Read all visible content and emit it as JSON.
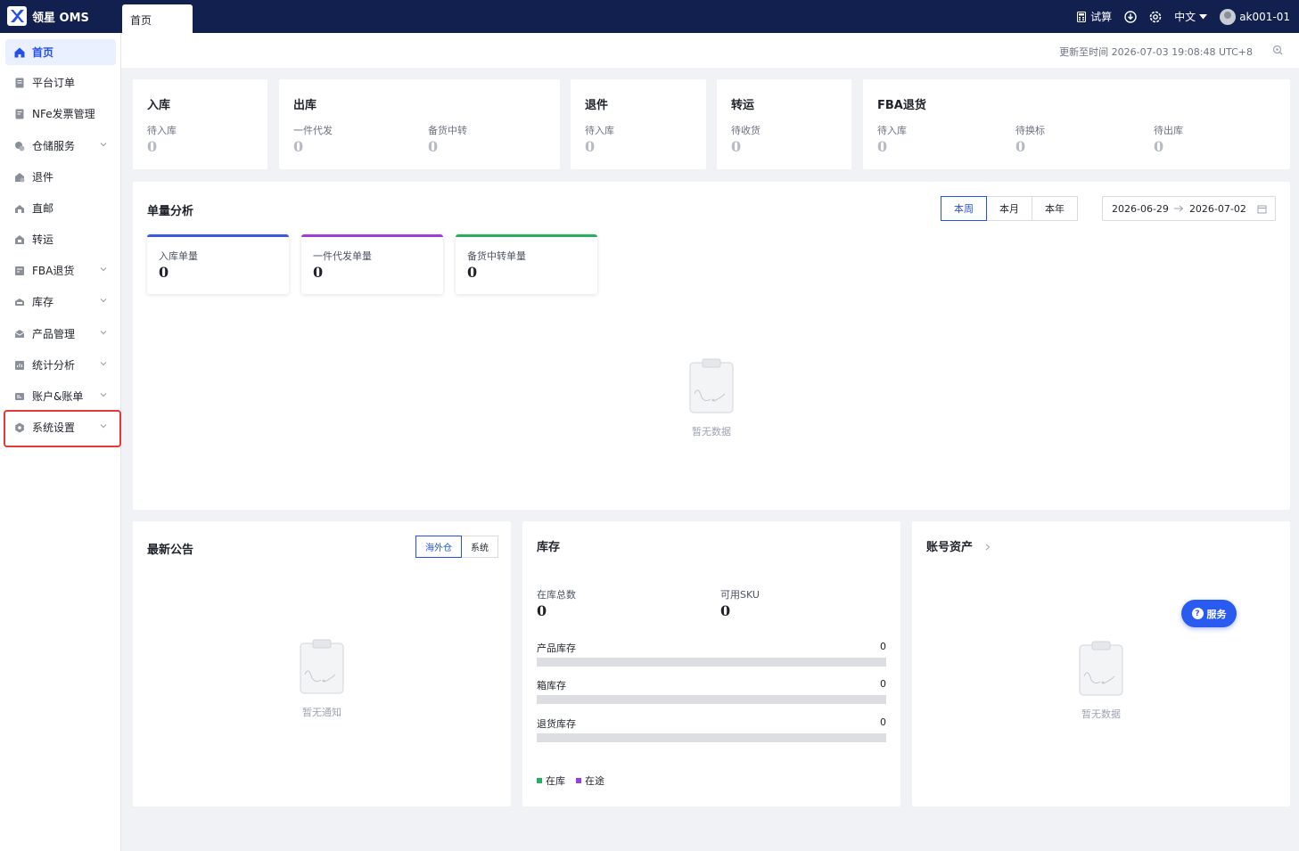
{
  "app": {
    "title": "领星 OMS",
    "active_tab": "首页"
  },
  "topbar": {
    "trial": "试算",
    "language": "中文",
    "user": "ak001-01"
  },
  "sidebar": {
    "items": [
      {
        "label": "首页",
        "icon": "home-icon",
        "active": true
      },
      {
        "label": "平台订单",
        "icon": "order-icon"
      },
      {
        "label": "NFe发票管理",
        "icon": "invoice-icon"
      },
      {
        "label": "仓储服务",
        "icon": "warehouse-icon",
        "expandable": true
      },
      {
        "label": "退件",
        "icon": "return-icon"
      },
      {
        "label": "直邮",
        "icon": "mail-icon"
      },
      {
        "label": "转运",
        "icon": "transfer-icon"
      },
      {
        "label": "FBA退货",
        "icon": "fba-icon",
        "expandable": true
      },
      {
        "label": "库存",
        "icon": "inventory-icon",
        "expandable": true
      },
      {
        "label": "产品管理",
        "icon": "product-icon",
        "expandable": true
      },
      {
        "label": "统计分析",
        "icon": "stats-icon",
        "expandable": true
      },
      {
        "label": "账户&账单",
        "icon": "account-icon",
        "expandable": true
      },
      {
        "label": "系统设置",
        "icon": "settings-icon",
        "expandable": true,
        "highlighted": true
      }
    ]
  },
  "header": {
    "update_time": "更新至时间 2026-07-03 19:08:48 UTC+8"
  },
  "stats": {
    "inbound": {
      "title": "入库",
      "items": [
        {
          "label": "待入库",
          "value": "0"
        }
      ]
    },
    "outbound": {
      "title": "出库",
      "items": [
        {
          "label": "一件代发",
          "value": "0"
        },
        {
          "label": "备货中转",
          "value": "0"
        }
      ]
    },
    "returns": {
      "title": "退件",
      "items": [
        {
          "label": "待入库",
          "value": "0"
        }
      ]
    },
    "transfer": {
      "title": "转运",
      "items": [
        {
          "label": "待收货",
          "value": "0"
        }
      ]
    },
    "fba": {
      "title": "FBA退货",
      "items": [
        {
          "label": "待入库",
          "value": "0"
        },
        {
          "label": "待换标",
          "value": "0"
        },
        {
          "label": "待出库",
          "value": "0"
        }
      ]
    }
  },
  "analysis": {
    "title": "单量分析",
    "periods": [
      "本周",
      "本月",
      "本年"
    ],
    "selected_period": "本周",
    "date_start": "2026-06-29",
    "date_end": "2026-07-02",
    "cards": [
      {
        "label": "入库单量",
        "value": "0",
        "color": "#3b5bdb"
      },
      {
        "label": "一件代发单量",
        "value": "0",
        "color": "#9b3fd6"
      },
      {
        "label": "备货中转单量",
        "value": "0",
        "color": "#27ae60"
      }
    ],
    "empty_text": "暂无数据"
  },
  "announcements": {
    "title": "最新公告",
    "tabs": [
      "海外仓",
      "系统"
    ],
    "selected_tab": "海外仓",
    "empty_text": "暂无通知"
  },
  "inventory": {
    "title": "库存",
    "total_label": "在库总数",
    "total_value": "0",
    "sku_label": "可用SKU",
    "sku_value": "0",
    "rows": [
      {
        "label": "产品库存",
        "value": "0"
      },
      {
        "label": "箱库存",
        "value": "0"
      },
      {
        "label": "退货库存",
        "value": "0"
      }
    ],
    "legend": [
      {
        "label": "在库",
        "color": "#27ae60"
      },
      {
        "label": "在途",
        "color": "#9b3fd6"
      }
    ]
  },
  "assets": {
    "title": "账号资产",
    "empty_text": "暂无数据"
  },
  "service": {
    "label": "服务"
  },
  "colors": {
    "topbar": "#12204f",
    "accent": "#2450e8",
    "highlight": "#e53935"
  }
}
